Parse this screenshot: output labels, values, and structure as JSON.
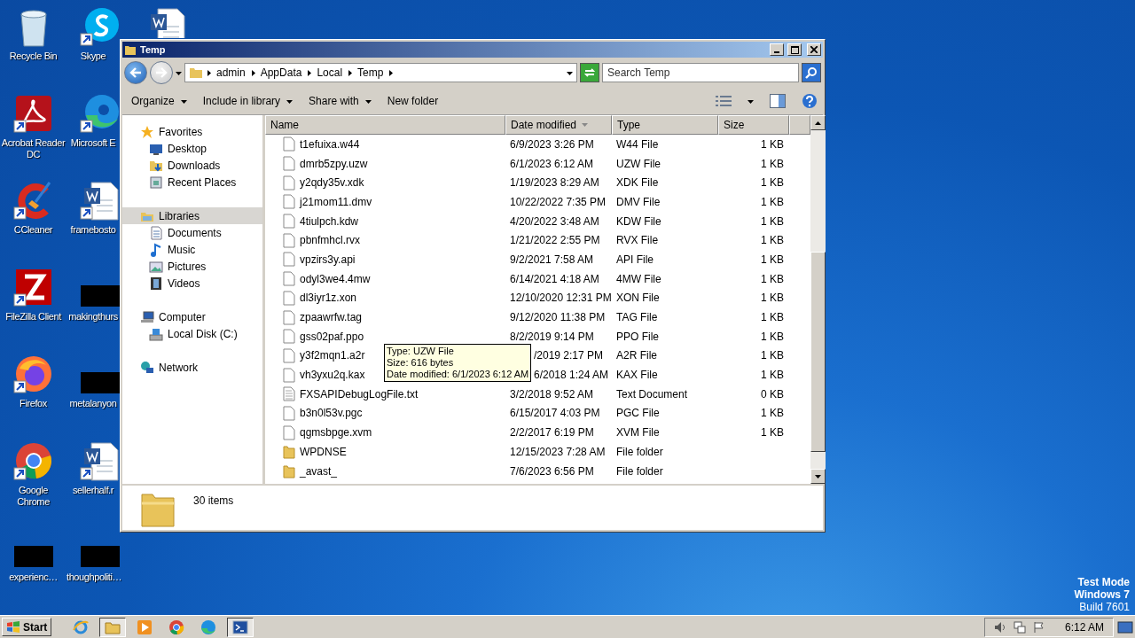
{
  "desktop": {
    "columns": [
      [
        {
          "kind": "recycle-bin",
          "label": "Recycle Bin",
          "shortcut": false
        },
        {
          "kind": "acrobat",
          "label": "Acrobat Reader DC",
          "shortcut": true
        },
        {
          "kind": "ccleaner",
          "label": "CCleaner",
          "shortcut": true
        },
        {
          "kind": "filezilla",
          "label": "FileZilla Client",
          "shortcut": true
        },
        {
          "kind": "firefox",
          "label": "Firefox",
          "shortcut": true
        },
        {
          "kind": "chrome",
          "label": "Google Chrome",
          "shortcut": true
        },
        {
          "kind": "redacted",
          "label": "experienc…",
          "shortcut": false
        }
      ],
      [
        {
          "kind": "skype",
          "label": "Skype",
          "shortcut": true
        },
        {
          "kind": "edge",
          "label": "Microsoft E",
          "shortcut": true
        },
        {
          "kind": "word",
          "label": "framebosto",
          "shortcut": true
        },
        {
          "kind": "redacted",
          "label": "makingthurs",
          "shortcut": false
        },
        {
          "kind": "redacted",
          "label": "metalanyon",
          "shortcut": false
        },
        {
          "kind": "word",
          "label": "sellerhalf.r",
          "shortcut": true
        },
        {
          "kind": "redacted",
          "label": "thoughpoliti…",
          "shortcut": false
        }
      ],
      [
        {
          "kind": "word",
          "shortcut": false
        }
      ]
    ],
    "os_notice": [
      {
        "text": "Test Mode",
        "bold": true
      },
      {
        "text": "Windows 7",
        "bold": true
      },
      {
        "text": "Build 7601",
        "bold": false
      }
    ]
  },
  "window": {
    "title": "Temp",
    "crumbs": [
      "admin",
      "AppData",
      "Local",
      "Temp"
    ],
    "search": {
      "placeholder": "Search Temp"
    },
    "toolbar": [
      {
        "label": "Organize",
        "dropdown": true
      },
      {
        "label": "Include in library",
        "dropdown": true
      },
      {
        "label": "Share with",
        "dropdown": true
      },
      {
        "label": "New folder",
        "dropdown": false
      }
    ],
    "nav": [
      {
        "label": "Favorites",
        "kind": "star",
        "selected": false,
        "children": [
          {
            "label": "Desktop",
            "kind": "desktop",
            "selected": false
          },
          {
            "label": "Downloads",
            "kind": "downloads",
            "selected": false
          },
          {
            "label": "Recent Places",
            "kind": "recent",
            "selected": false
          }
        ]
      },
      {
        "label": "Libraries",
        "kind": "libraries",
        "selected": true,
        "children": [
          {
            "label": "Documents",
            "kind": "documents",
            "selected": false
          },
          {
            "label": "Music",
            "kind": "music",
            "selected": false
          },
          {
            "label": "Pictures",
            "kind": "pictures",
            "selected": false
          },
          {
            "label": "Videos",
            "kind": "videos",
            "selected": false
          }
        ]
      },
      {
        "label": "Computer",
        "kind": "computer",
        "selected": false,
        "children": [
          {
            "label": "Local Disk (C:)",
            "kind": "disk",
            "selected": false
          }
        ]
      },
      {
        "label": "Network",
        "kind": "network",
        "selected": false
      }
    ],
    "columns": [
      {
        "label": "Name",
        "sorted": false
      },
      {
        "label": "Date modified",
        "sorted": true
      },
      {
        "label": "Type",
        "sorted": false
      },
      {
        "label": "Size",
        "sorted": false
      }
    ],
    "rows": [
      {
        "kind": "file",
        "name": "t1efuixa.w44",
        "date": "6/9/2023 3:26 PM",
        "type": "W44 File",
        "size": "1 KB"
      },
      {
        "kind": "file",
        "name": "dmrb5zpy.uzw",
        "date": "6/1/2023 6:12 AM",
        "type": "UZW File",
        "size": "1 KB"
      },
      {
        "kind": "file",
        "name": "y2qdy35v.xdk",
        "date": "1/19/2023 8:29 AM",
        "type": "XDK File",
        "size": "1 KB"
      },
      {
        "kind": "file",
        "name": "j21mom11.dmv",
        "date": "10/22/2022 7:35 PM",
        "type": "DMV File",
        "size": "1 KB"
      },
      {
        "kind": "file",
        "name": "4tiulpch.kdw",
        "date": "4/20/2022 3:48 AM",
        "type": "KDW File",
        "size": "1 KB"
      },
      {
        "kind": "file",
        "name": "pbnfmhcl.rvx",
        "date": "1/21/2022 2:55 PM",
        "type": "RVX File",
        "size": "1 KB"
      },
      {
        "kind": "file",
        "name": "vpzirs3y.api",
        "date": "9/2/2021 7:58 AM",
        "type": "API File",
        "size": "1 KB"
      },
      {
        "kind": "file",
        "name": "odyl3we4.4mw",
        "date": "6/14/2021 4:18 AM",
        "type": "4MW File",
        "size": "1 KB"
      },
      {
        "kind": "file",
        "name": "dl3iyr1z.xon",
        "date": "12/10/2020 12:31 PM",
        "type": "XON File",
        "size": "1 KB"
      },
      {
        "kind": "file",
        "name": "zpaawrfw.tag",
        "date": "9/12/2020 11:38 PM",
        "type": "TAG File",
        "size": "1 KB"
      },
      {
        "kind": "file",
        "name": "gss02paf.ppo",
        "date": "8/2/2019 9:14 PM",
        "type": "PPO File",
        "size": "1 KB"
      },
      {
        "kind": "file",
        "name": "y3f2mqn1.a2r",
        "date": "/2019 2:17 PM",
        "date_partly_hidden": true,
        "type": "A2R File",
        "size": "1 KB"
      },
      {
        "kind": "file",
        "name": "vh3yxu2q.kax",
        "date": "6/2018 1:24 AM",
        "date_partly_hidden": true,
        "type": "KAX File",
        "size": "1 KB"
      },
      {
        "kind": "text",
        "name": "FXSAPIDebugLogFile.txt",
        "date": "3/2/2018 9:52 AM",
        "type": "Text Document",
        "size": "0 KB"
      },
      {
        "kind": "file",
        "name": "b3n0l53v.pgc",
        "date": "6/15/2017 4:03 PM",
        "type": "PGC File",
        "size": "1 KB"
      },
      {
        "kind": "file",
        "name": "qgmsbpge.xvm",
        "date": "2/2/2017 6:19 PM",
        "type": "XVM File",
        "size": "1 KB"
      },
      {
        "kind": "folder",
        "name": "WPDNSE",
        "date": "12/15/2023 7:28 AM",
        "type": "File folder"
      },
      {
        "kind": "folder",
        "name": "_avast_",
        "date": "7/6/2023 6:56 PM",
        "type": "File folder"
      }
    ],
    "tooltip": [
      "Type: UZW File",
      "Size: 616 bytes",
      "Date modified: 6/1/2023 6:12 AM"
    ],
    "details": {
      "count": "30 items"
    }
  },
  "taskbar": {
    "start": "Start",
    "apps": [
      {
        "kind": "ie",
        "active": false
      },
      {
        "kind": "explorer",
        "active": true
      },
      {
        "kind": "media",
        "active": false
      },
      {
        "kind": "chrome",
        "active": false
      },
      {
        "kind": "edge",
        "active": false
      },
      {
        "kind": "terminal",
        "active": true
      }
    ],
    "clock": "6:12 AM"
  }
}
